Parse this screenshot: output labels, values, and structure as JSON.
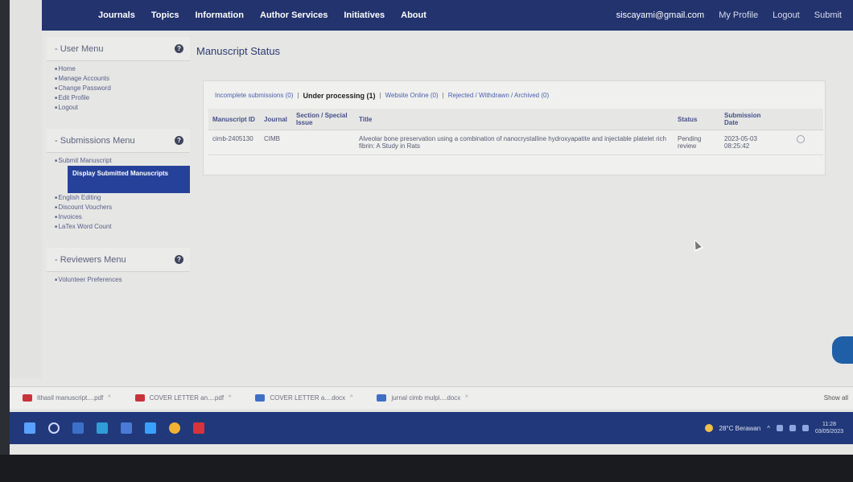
{
  "nav": {
    "left": [
      "Journals",
      "Topics",
      "Information",
      "Author Services",
      "Initiatives",
      "About"
    ],
    "email": "siscayami@gmail.com",
    "my_profile": "My Profile",
    "logout": "Logout",
    "submit": "Submit"
  },
  "user_menu": {
    "title": "- User Menu",
    "items": [
      "Home",
      "Manage Accounts",
      "Change Password",
      "Edit Profile",
      "Logout"
    ]
  },
  "submissions_menu": {
    "title": "- Submissions Menu",
    "items": [
      "Submit Manuscript",
      "Display Submitted Manuscripts",
      "English Editing",
      "Discount Vouchers",
      "Invoices",
      "LaTex Word Count"
    ],
    "active_index": 1
  },
  "reviewers_menu": {
    "title": "- Reviewers Menu",
    "items": [
      "Volunteer Preferences"
    ]
  },
  "page_title": "Manuscript Status",
  "tabs": [
    {
      "label": "Incomplete submissions (0)",
      "active": false
    },
    {
      "label": "Under processing (1)",
      "active": true
    },
    {
      "label": "Website Online (0)",
      "active": false
    },
    {
      "label": "Rejected / Withdrawn / Archived (0)",
      "active": false
    }
  ],
  "table": {
    "headers": [
      "Manuscript ID",
      "Journal",
      "Section / Special Issue",
      "Title",
      "Status",
      "Submission Date"
    ],
    "rows": [
      {
        "id": "cimb-2405130",
        "journal": "CIMB",
        "section": "",
        "title": "Alveolar bone preservation using a combination of nanocrystalline hydroxyapatite and injectable platelet rich fibrin: A Study in Rats",
        "status": "Pending review",
        "date": "2023-05-03 08:25:42"
      }
    ]
  },
  "downloads": [
    {
      "name": "Ithasil manuscript....pdf",
      "type": "pdf"
    },
    {
      "name": "COVER LETTER an....pdf",
      "type": "pdf"
    },
    {
      "name": "COVER LETTER a....docx",
      "type": "doc"
    },
    {
      "name": "jurnal cimb mulpi....docx",
      "type": "doc"
    }
  ],
  "downloads_show_all": "Show all",
  "tray": {
    "weather": "28°C Berawan",
    "time": "11:28",
    "date": "03/05/2023"
  },
  "colors": {
    "nav_bg": "#22336e",
    "active_menu": "#25419a",
    "taskbar": "#21397a"
  }
}
